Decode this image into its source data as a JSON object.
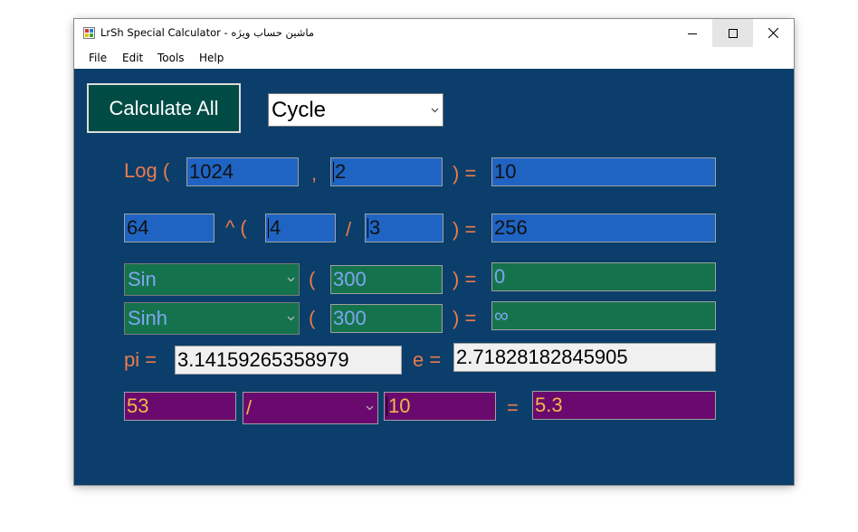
{
  "window": {
    "title": "LrSh Special Calculator - ماشین حساب ویژه",
    "controls": {
      "minimize": "minimize-icon",
      "maximize": "maximize-icon",
      "close": "close-icon"
    }
  },
  "menu": [
    "File",
    "Edit",
    "Tools",
    "Help"
  ],
  "toolbar": {
    "calculate_label": "Calculate All",
    "mode_selected": "Cycle"
  },
  "log_row": {
    "label": "Log (",
    "base": "1024",
    "comma": ",",
    "arg": "2",
    "eq": ") =",
    "result": "10"
  },
  "pow_row": {
    "base": "64",
    "op": "^ (",
    "num": "4",
    "slash": "/",
    "den": "3",
    "eq": ") =",
    "result": "256"
  },
  "trig_row": {
    "func": "Sin",
    "open": "(",
    "arg": "300",
    "eq": ") =",
    "result": "0"
  },
  "hyper_row": {
    "func": "Sinh",
    "open": "(",
    "arg": "300",
    "eq": ") =",
    "result": "∞"
  },
  "const_row": {
    "pi_label": "pi =",
    "pi_value": "3.14159265358979",
    "e_label": "e =",
    "e_value": "2.71828182845905"
  },
  "arith_row": {
    "a": "53",
    "op": "/",
    "b": "10",
    "eq": "=",
    "result": "5.3"
  },
  "colors": {
    "background": "#0b3e6b",
    "label_orange": "#ec7a4c",
    "field_blue": "#1f64c3",
    "field_green": "#14734d",
    "field_purple": "#6b0a6e",
    "button_teal": "#004c45"
  }
}
